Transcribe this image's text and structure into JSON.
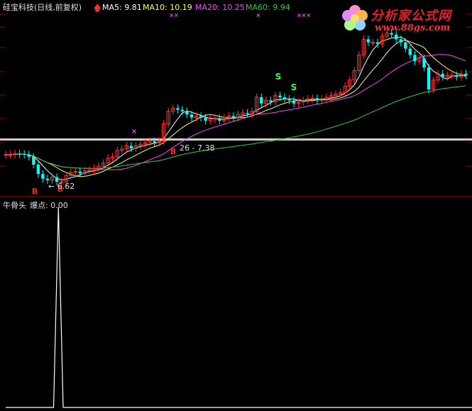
{
  "header": {
    "stock_name": "硅宝科技(日线,前复权)",
    "ma5": "MA5: 9.81",
    "ma10": "MA10: 10.19",
    "ma20": "MA20: 10.25",
    "ma60": "MA60: 9.94",
    "ma_colors": {
      "ma5": "#ffffff",
      "ma10": "#ffff66",
      "ma20": "#ff44ff",
      "ma60": "#33cc33"
    }
  },
  "watermark": {
    "title": "分析家公式网",
    "url": "www.88gs.com"
  },
  "indicator": {
    "name": "牛骨头",
    "label": "爆点: 0.00"
  },
  "annotations": {
    "low_label": "← 6.62",
    "range_label": "26 - 7.38",
    "buy_marker": "B",
    "sell_marker": "S",
    "cross_marker": "×"
  },
  "colors": {
    "up": "#ff3232",
    "down": "#00ffff",
    "grid": "#8b0000",
    "indicator_line": "#ffffff",
    "buy": "#ff2020",
    "sell": "#33ff33",
    "cross": "#ff44ff"
  },
  "chart_data": [
    {
      "type": "candlestick",
      "title": "硅宝科技(日线,前复权)",
      "x": [
        1,
        2,
        3,
        4,
        5,
        6,
        7,
        8,
        9,
        10,
        11,
        12,
        13,
        14,
        15,
        16,
        17,
        18,
        19,
        20,
        21,
        22,
        23,
        24,
        25,
        26,
        27,
        28,
        29,
        30,
        31,
        32,
        33,
        34,
        35,
        36,
        37,
        38,
        39,
        40,
        41,
        42,
        43,
        44,
        45,
        46,
        47,
        48,
        49,
        50,
        51,
        52,
        53,
        54,
        55,
        56,
        57,
        58,
        59,
        60,
        61,
        62,
        63,
        64,
        65,
        66,
        67,
        68,
        69,
        70,
        71,
        72,
        73,
        74,
        75,
        76,
        77,
        78,
        79,
        80,
        81,
        82,
        83,
        84,
        85,
        86,
        87,
        88,
        89,
        90,
        91,
        92,
        93,
        94,
        95,
        96,
        97,
        98,
        99,
        100
      ],
      "open": [
        7.6,
        7.62,
        7.62,
        7.65,
        7.64,
        7.62,
        7.55,
        7.3,
        7.0,
        6.85,
        6.8,
        6.9,
        6.75,
        6.75,
        6.95,
        7.05,
        7.08,
        7.02,
        7.1,
        7.12,
        7.18,
        7.25,
        7.35,
        7.5,
        7.55,
        7.75,
        7.8,
        7.9,
        7.82,
        7.9,
        7.95,
        8.0,
        8.05,
        8.0,
        8.05,
        8.6,
        9.0,
        9.1,
        9.05,
        9.0,
        8.9,
        8.8,
        8.85,
        8.8,
        8.7,
        8.75,
        8.78,
        8.7,
        8.8,
        8.85,
        8.8,
        8.9,
        8.95,
        8.92,
        9.0,
        9.45,
        9.25,
        9.35,
        9.3,
        9.5,
        9.45,
        9.4,
        9.35,
        9.25,
        9.3,
        9.35,
        9.4,
        9.42,
        9.35,
        9.4,
        9.45,
        9.5,
        9.55,
        9.6,
        9.8,
        10.0,
        10.3,
        10.8,
        11.3,
        11.2,
        11.2,
        11.15,
        11.4,
        11.5,
        11.45,
        11.3,
        11.2,
        11.0,
        10.8,
        10.6,
        10.7,
        10.4,
        9.7,
        10.0,
        10.2,
        10.1,
        10.15,
        10.15,
        10.1,
        10.2
      ],
      "close": [
        7.62,
        7.62,
        7.65,
        7.64,
        7.62,
        7.55,
        7.3,
        7.0,
        6.85,
        6.8,
        6.9,
        6.75,
        6.75,
        6.95,
        7.05,
        7.08,
        7.02,
        7.1,
        7.12,
        7.18,
        7.25,
        7.35,
        7.5,
        7.55,
        7.75,
        7.8,
        7.9,
        7.82,
        7.9,
        7.95,
        8.0,
        8.05,
        8.0,
        8.05,
        8.6,
        9.0,
        9.1,
        9.05,
        9.0,
        8.9,
        8.8,
        8.85,
        8.8,
        8.7,
        8.75,
        8.78,
        8.7,
        8.8,
        8.85,
        8.8,
        8.9,
        8.95,
        8.92,
        9.0,
        9.45,
        9.25,
        9.35,
        9.3,
        9.5,
        9.45,
        9.4,
        9.35,
        9.25,
        9.3,
        9.35,
        9.4,
        9.42,
        9.35,
        9.4,
        9.45,
        9.5,
        9.55,
        9.6,
        9.8,
        10.0,
        10.3,
        10.8,
        11.3,
        11.2,
        11.2,
        11.15,
        11.4,
        11.5,
        11.45,
        11.3,
        11.2,
        11.0,
        10.8,
        10.6,
        10.7,
        10.4,
        9.7,
        10.0,
        10.2,
        10.1,
        10.15,
        10.15,
        10.1,
        10.2,
        10.15
      ],
      "ylim": [
        6.3,
        12.1
      ]
    },
    {
      "type": "line",
      "name": "牛骨头",
      "series": [
        {
          "name": "爆点",
          "values": [
            0,
            0,
            0,
            0,
            0,
            0,
            0,
            0,
            0,
            0,
            0,
            1,
            0,
            0,
            0,
            0,
            0,
            0,
            0,
            0,
            0,
            0,
            0,
            0,
            0,
            0,
            0,
            0,
            0,
            0,
            0,
            0,
            0,
            0,
            0,
            0,
            0,
            0,
            0,
            0,
            0,
            0,
            0,
            0,
            0,
            0,
            0,
            0,
            0,
            0,
            0,
            0,
            0,
            0,
            0,
            0,
            0,
            0,
            0,
            0,
            0,
            0,
            0,
            0,
            0,
            0,
            0,
            0,
            0,
            0,
            0,
            0,
            0,
            0,
            0,
            0,
            0,
            0,
            0,
            0,
            0,
            0,
            0,
            0,
            0,
            0,
            0,
            0,
            0,
            0,
            0,
            0,
            0,
            0,
            0,
            0,
            0,
            0,
            0,
            0
          ]
        }
      ],
      "ylim": [
        0,
        1
      ]
    }
  ]
}
